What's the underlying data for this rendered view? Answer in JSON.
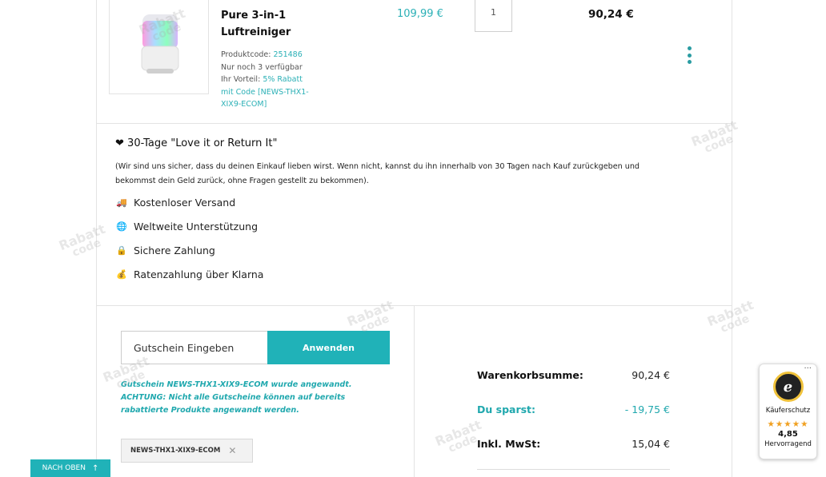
{
  "product": {
    "name_line1": "Pure 3-in-1",
    "name_line2": "Luftreiniger",
    "code_label": "Produktcode:",
    "code_value": "251486",
    "stock": "Nur noch 3 verfügbar",
    "advantage_label": "Ihr Vorteil:",
    "advantage_value_line1": "5% Rabatt",
    "advantage_value_line2": "mit Code [NEWS-THX1-",
    "advantage_value_line3": "XIX9-ECOM]",
    "unit_price": "109,99 €",
    "quantity": "1",
    "line_total": "90,24 €"
  },
  "guarantee": {
    "icon": "heart-icon",
    "title": "30-Tage \"Love it or Return It\"",
    "text": "(Wir sind uns sicher, dass du deinen Einkauf lieben wirst. Wenn nicht, kannst du ihn innerhalb von 30 Tagen nach Kauf zurückgeben und bekommst dein Geld zurück, ohne Fragen gestellt zu bekommen)."
  },
  "features": [
    {
      "icon": "truck-icon",
      "label": "Kostenloser Versand"
    },
    {
      "icon": "globe-icon",
      "label": "Weltweite Unterstützung"
    },
    {
      "icon": "lock-icon",
      "label": "Sichere Zahlung"
    },
    {
      "icon": "money-bag-icon",
      "label": "Ratenzahlung über Klarna"
    }
  ],
  "coupon": {
    "placeholder": "Gutschein Eingeben",
    "apply_label": "Anwenden",
    "message_line1": "Gutschein NEWS-THX1-XIX9-ECOM wurde angewandt.",
    "message_line2": "ACHTUNG: Nicht alle Gutscheine können auf bereits",
    "message_line3": "rabattierte Produkte angewandt werden.",
    "applied_code": "NEWS-THX1-XIX9-ECOM",
    "remove_symbol": "✕"
  },
  "summary": {
    "subtotal_label": "Warenkorbsumme:",
    "subtotal_value": "90,24 €",
    "savings_label": "Du sparst:",
    "savings_value": "- 19,75 €",
    "tax_label": "Inkl. MwSt:",
    "tax_value": "15,04 €"
  },
  "back_to_top": {
    "label": "NACH OBEN",
    "arrow": "↑"
  },
  "trust_badge": {
    "seal_letter": "e",
    "label": "Käuferschutz",
    "rating": "4,85",
    "stars_shown": 5,
    "verdict": "Hervorragend",
    "menu": "···"
  },
  "watermark": {
    "line1": "Rabatt",
    "line2": "code"
  },
  "colors": {
    "accent": "#20b2b8",
    "text": "#222222",
    "border": "#e3e3e3"
  }
}
